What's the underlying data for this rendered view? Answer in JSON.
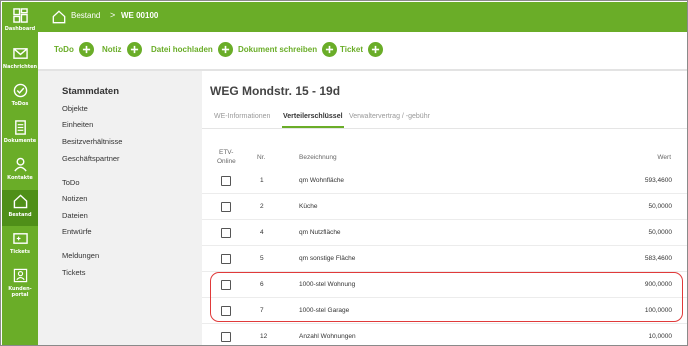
{
  "nav": {
    "items": [
      {
        "label": "Dashboard",
        "icon": "dashboard-icon"
      },
      {
        "label": "Nachrichten",
        "icon": "mail-icon"
      },
      {
        "label": "ToDos",
        "icon": "check-circle-icon"
      },
      {
        "label": "Dokumente",
        "icon": "document-icon"
      },
      {
        "label": "Kontakte",
        "icon": "user-icon"
      },
      {
        "label": "Bestand",
        "icon": "home-icon"
      },
      {
        "label": "Tickets",
        "icon": "ticket-icon"
      },
      {
        "label": "Kunden-\nportal",
        "icon": "portal-icon"
      }
    ],
    "active": "Bestand"
  },
  "breadcrumb": {
    "items": [
      "Bestand",
      "WE 00100"
    ],
    "separator": ">"
  },
  "actions": [
    {
      "label": "ToDo"
    },
    {
      "label": "Notiz"
    },
    {
      "label": "Datei hochladen"
    },
    {
      "label": "Dokument schreiben"
    },
    {
      "label": "Ticket"
    }
  ],
  "side": {
    "title": "Stammdaten",
    "group1": [
      "Objekte",
      "Einheiten",
      "Besitzverhältnisse",
      "Geschäftspartner"
    ],
    "group2": [
      "ToDo",
      "Notizen",
      "Dateien",
      "Entwürfe"
    ],
    "group3": [
      "Meldungen",
      "Tickets"
    ]
  },
  "main": {
    "title": "WEG Mondstr. 15 - 19d",
    "tabs": [
      "WE-Informationen",
      "Verteilerschlüssel",
      "Verwaltervertrag / -gebühr"
    ],
    "active_tab": "Verteilerschlüssel"
  },
  "table": {
    "headers": {
      "etv_line1": "ETV-",
      "etv_line2": "Online",
      "nr": "Nr.",
      "bez": "Bezeichnung",
      "wert": "Wert"
    },
    "rows": [
      {
        "nr": "1",
        "bez": "qm Wohnfläche",
        "wert": "593,4600"
      },
      {
        "nr": "2",
        "bez": "Küche",
        "wert": "50,0000"
      },
      {
        "nr": "4",
        "bez": "qm Nutzfläche",
        "wert": "50,0000"
      },
      {
        "nr": "5",
        "bez": "qm sonstige Fläche",
        "wert": "583,4600"
      },
      {
        "nr": "6",
        "bez": "1000-stel Wohnung",
        "wert": "900,0000"
      },
      {
        "nr": "7",
        "bez": "1000-stel Garage",
        "wert": "100,0000"
      },
      {
        "nr": "12",
        "bez": "Anzahl Wohnungen",
        "wert": "10,0000"
      }
    ]
  },
  "colors": {
    "accent": "#6aad28",
    "highlight": "#e03a3a"
  }
}
